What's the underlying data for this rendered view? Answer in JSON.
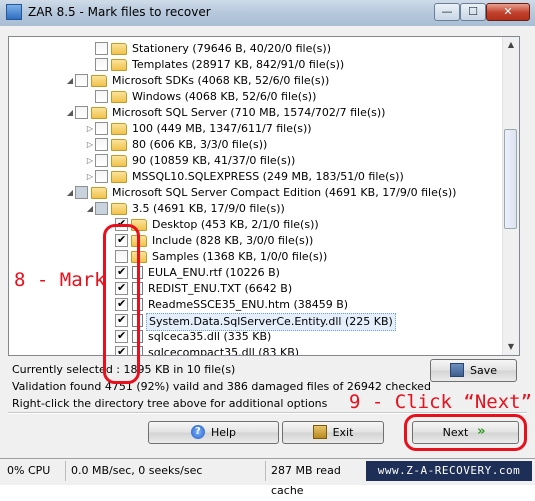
{
  "window": {
    "title": "ZAR 8.5 - Mark files to recover",
    "minimize": "—",
    "maximize": "☐",
    "close": "✕"
  },
  "tree": [
    {
      "level": 3,
      "expander": "",
      "checkbox": "none",
      "icon": "folder",
      "label": "Stationery (79646 B, 40/20/0 file(s))"
    },
    {
      "level": 3,
      "expander": "",
      "checkbox": "none",
      "icon": "folder",
      "label": "Templates (28917 KB, 842/91/0 file(s))"
    },
    {
      "level": 2,
      "expander": "◢",
      "checkbox": "none",
      "icon": "folder",
      "label": "Microsoft SDKs (4068 KB, 52/6/0 file(s))"
    },
    {
      "level": 3,
      "expander": "",
      "checkbox": "none",
      "icon": "folder",
      "label": "Windows (4068 KB, 52/6/0 file(s))"
    },
    {
      "level": 2,
      "expander": "◢",
      "checkbox": "none",
      "icon": "folder",
      "label": "Microsoft SQL Server (710 MB, 1574/702/7 file(s))"
    },
    {
      "level": 3,
      "expander": "▷",
      "checkbox": "none",
      "icon": "folder",
      "label": "100 (449 MB, 1347/611/7 file(s))"
    },
    {
      "level": 3,
      "expander": "▷",
      "checkbox": "none",
      "icon": "folder",
      "label": "80 (606 KB, 3/3/0 file(s))"
    },
    {
      "level": 3,
      "expander": "▷",
      "checkbox": "none",
      "icon": "folder",
      "label": "90 (10859 KB, 41/37/0 file(s))"
    },
    {
      "level": 3,
      "expander": "▷",
      "checkbox": "none",
      "icon": "folder",
      "label": "MSSQL10.SQLEXPRESS (249 MB, 183/51/0 file(s))"
    },
    {
      "level": 2,
      "expander": "◢",
      "checkbox": "partial",
      "icon": "folder",
      "label": "Microsoft SQL Server Compact Edition (4691 KB, 17/9/0 file(s))"
    },
    {
      "level": 3,
      "expander": "◢",
      "checkbox": "partial",
      "icon": "folder",
      "label": "3.5 (4691 KB, 17/9/0 file(s))"
    },
    {
      "level": 4,
      "expander": "",
      "checkbox": "checked",
      "icon": "folder",
      "label": "Desktop (453 KB, 2/1/0 file(s))"
    },
    {
      "level": 4,
      "expander": "",
      "checkbox": "checked",
      "icon": "folder",
      "label": "Include (828 KB, 3/0/0 file(s))"
    },
    {
      "level": 4,
      "expander": "",
      "checkbox": "none",
      "icon": "folder",
      "label": "Samples (1368 KB, 1/0/0 file(s))"
    },
    {
      "level": 4,
      "expander": "",
      "checkbox": "checked",
      "icon": "file",
      "label": "EULA_ENU.rtf (10226 B)"
    },
    {
      "level": 4,
      "expander": "",
      "checkbox": "checked",
      "icon": "file",
      "label": "REDIST_ENU.TXT (6642 B)"
    },
    {
      "level": 4,
      "expander": "",
      "checkbox": "checked",
      "icon": "file",
      "label": "ReadmeSSCE35_ENU.htm (38459 B)"
    },
    {
      "level": 4,
      "expander": "",
      "checkbox": "checked",
      "icon": "file",
      "label": "System.Data.SqlServerCe.Entity.dll (225 KB)",
      "selected": true
    },
    {
      "level": 4,
      "expander": "",
      "checkbox": "checked",
      "icon": "file",
      "label": "sqlceca35.dll (335 KB)"
    },
    {
      "level": 4,
      "expander": "",
      "checkbox": "checked",
      "icon": "file",
      "label": "sqlcecompact35.dll (83 KB)"
    }
  ],
  "info": {
    "selected": "Currently selected : 1895 KB in 10 file(s)",
    "validation": "Validation found 4751 (92%) vaild and 386 damaged files of 26942 checked",
    "hint": "Right-click the directory tree above for additional options"
  },
  "buttons": {
    "save": "Save",
    "help": "Help",
    "exit": "Exit",
    "next": "Next"
  },
  "annotations": {
    "mark": "8 - Mark",
    "click_next": "9 - Click “Next”"
  },
  "statusbar": {
    "cpu": "0% CPU",
    "speed": "0.0 MB/sec, 0 seeks/sec",
    "cache": "287 MB read cache",
    "watermark": "www.Z-A-RECOVERY.com"
  },
  "colors": {
    "annotation": "#e8101c",
    "watermark_bg": "#1d2f57"
  }
}
